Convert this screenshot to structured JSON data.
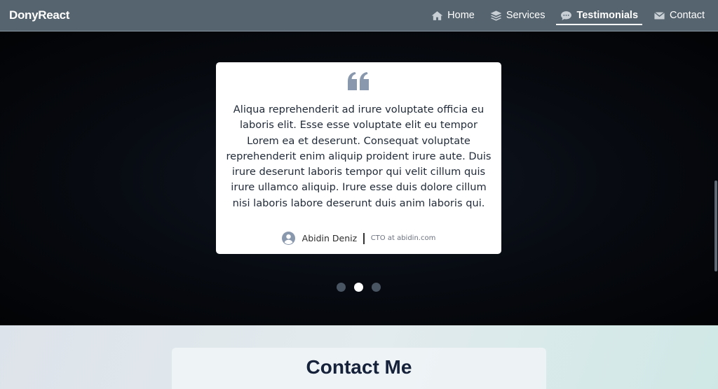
{
  "navbar": {
    "brand": "DonyReact",
    "items": [
      {
        "label": "Home",
        "icon": "home-icon",
        "active": false
      },
      {
        "label": "Services",
        "icon": "layers-icon",
        "active": false
      },
      {
        "label": "Testimonials",
        "icon": "chat-bubble-icon",
        "active": true
      },
      {
        "label": "Contact",
        "icon": "envelope-icon",
        "active": false
      }
    ]
  },
  "testimonial": {
    "quote": "Aliqua reprehenderit ad irure voluptate officia eu laboris elit. Esse esse voluptate elit eu tempor Lorem ea et deserunt. Consequat voluptate reprehenderit enim aliquip proident irure aute. Duis irure deserunt laboris tempor qui velit cillum quis irure ullamco aliquip. Irure esse duis dolore cillum nisi laboris labore deserunt duis anim laboris qui.",
    "author_name": "Abidin Deniz",
    "author_role": "CTO at abidin.com"
  },
  "carousel": {
    "slide_count": 3,
    "active_index": 1
  },
  "contact": {
    "title": "Contact Me"
  },
  "colors": {
    "navbar_bg": "#56646f",
    "quote_icon": "#8a98ad",
    "dot_inactive": "#4a5563",
    "dot_active": "#ffffff",
    "contact_title": "#16213a"
  }
}
